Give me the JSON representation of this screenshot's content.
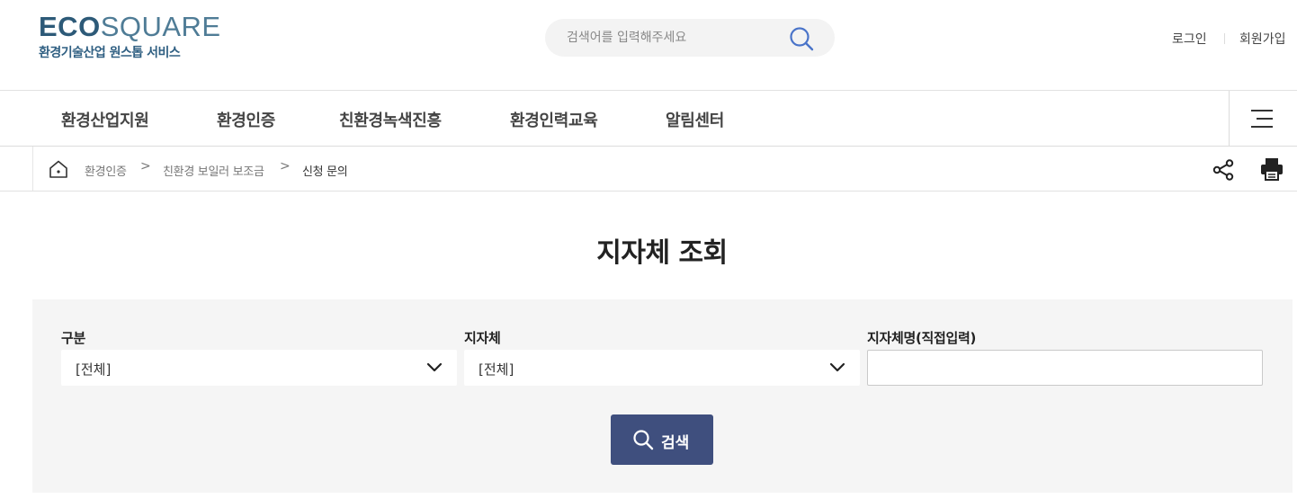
{
  "header": {
    "logo": {
      "bold": "ECO",
      "light": "SQUARE",
      "subtitle": "환경기술산업 원스톱 서비스"
    },
    "search": {
      "placeholder": "검색어를 입력해주세요",
      "icon": "search-icon",
      "icon_color": "#4a74c9"
    },
    "util": {
      "login": "로그인",
      "join": "회원가입"
    }
  },
  "gnb": {
    "items": [
      "환경산업지원",
      "환경인증",
      "친환경녹색진흥",
      "환경인력교육",
      "알림센터"
    ],
    "menu_icon": "hamburger-menu-icon"
  },
  "location": {
    "home_icon": "home-icon",
    "crumbs": [
      "환경인증",
      "친환경 보일러 보조금",
      "신청 문의"
    ],
    "separator": ">",
    "share_icon": "share-icon",
    "print_icon": "print-icon"
  },
  "main": {
    "title": "지자체 조회",
    "form": {
      "category": {
        "label": "구분",
        "value": "[전체]"
      },
      "municipality": {
        "label": "지자체",
        "value": "[전체]"
      },
      "municipality_name": {
        "label": "지자체명(직접입력)",
        "value": ""
      },
      "search_button": {
        "label": "검색",
        "color": "#3f4f7e"
      }
    }
  }
}
